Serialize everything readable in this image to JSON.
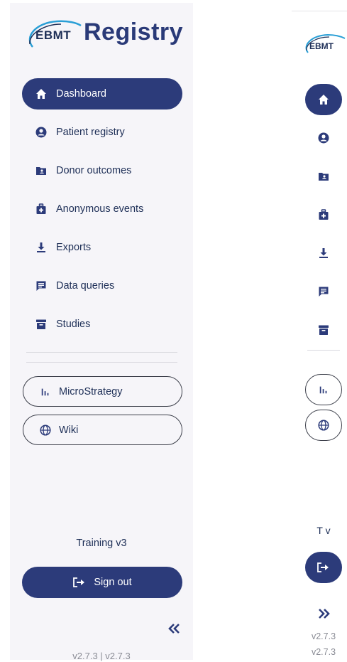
{
  "expanded": {
    "logo": {
      "brand": "EBMT",
      "product": "Registry"
    },
    "nav": [
      {
        "label": "Dashboard",
        "icon": "home-icon",
        "active": true
      },
      {
        "label": "Patient registry",
        "icon": "user-circle-icon"
      },
      {
        "label": "Donor outcomes",
        "icon": "folder-user-icon"
      },
      {
        "label": "Anonymous events",
        "icon": "medical-bag-icon"
      },
      {
        "label": "Exports",
        "icon": "download-icon"
      },
      {
        "label": "Data queries",
        "icon": "comment-text-icon"
      },
      {
        "label": "Studies",
        "icon": "archive-box-icon"
      }
    ],
    "links": [
      {
        "label": "MicroStrategy",
        "icon": "bar-chart-icon"
      },
      {
        "label": "Wiki",
        "icon": "globe-icon"
      }
    ],
    "environment": "Training v3",
    "signout_label": "Sign out",
    "collapse_icon": "double-chevron-left-icon",
    "version": "v2.7.3 | v2.7.3"
  },
  "collapsed": {
    "logo": {
      "brand": "EBMT"
    },
    "environment": "T v",
    "expand_icon": "double-chevron-right-icon",
    "version_1": "v2.7.3",
    "version_2": "v2.7.3"
  },
  "colors": {
    "primary": "#2c3b7a",
    "sidebar_bg": "#f6f5f9",
    "text": "#1e2f57",
    "muted": "#8a8c95",
    "logo_swoosh": "#2a9fd6"
  }
}
